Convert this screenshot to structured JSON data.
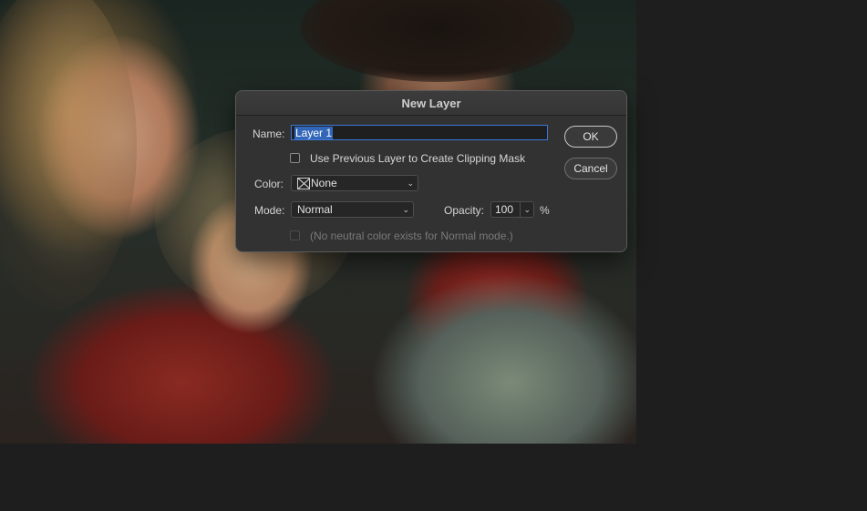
{
  "dialog": {
    "title": "New Layer",
    "name_label": "Name:",
    "name_value": "Layer 1",
    "clipping_checkbox_label": "Use Previous Layer to Create Clipping Mask",
    "clipping_checked": false,
    "color_label": "Color:",
    "color_value": "None",
    "mode_label": "Mode:",
    "mode_value": "Normal",
    "opacity_label": "Opacity:",
    "opacity_value": "100",
    "opacity_unit": "%",
    "neutral_checkbox_label": "(No neutral color exists for Normal mode.)",
    "neutral_enabled": false,
    "ok_label": "OK",
    "cancel_label": "Cancel"
  },
  "icons": {
    "chevron": "chevron-down-icon",
    "color_swatch": "no-color-swatch-icon"
  },
  "colors": {
    "dialog_bg": "#323232",
    "focus_ring": "#3b78d8",
    "selection": "#3266b8",
    "workspace_bg": "#1e1e1e"
  }
}
